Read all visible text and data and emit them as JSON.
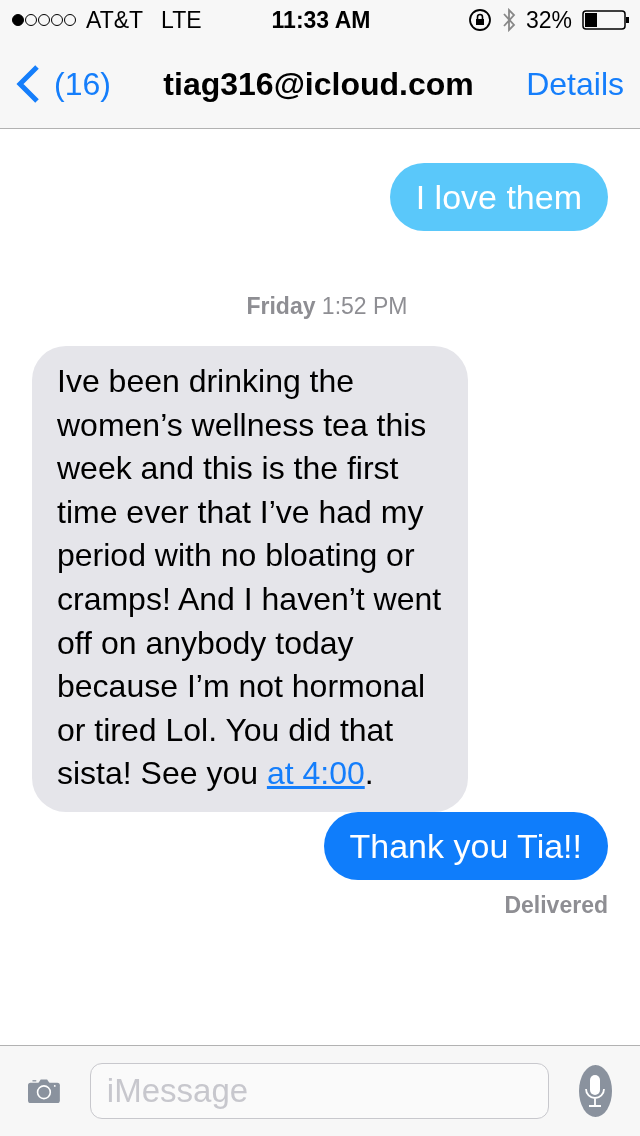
{
  "status_bar": {
    "carrier": "AT&T",
    "network": "LTE",
    "time": "11:33 AM",
    "battery": "32%"
  },
  "nav": {
    "back": "(16)",
    "title": "tiag316@icloud.com",
    "action": "Details"
  },
  "messages": [
    {
      "kind": "outgoing",
      "text": "I love them",
      "color": "#5ac8fa"
    },
    {
      "kind": "timestamp",
      "text": "**Friday** 1:52 PM"
    },
    {
      "kind": "incoming",
      "text": "Ive been drinking the women’s wellness tea this week and this is the first time ever that I’ve had my period with no bloating or cramps! And I haven’t went off on anybody today because I’m not hormonal or tired Lol. You did that sista! See you ",
      "link": "at 4:00",
      "text_after": "."
    },
    {
      "kind": "outgoing",
      "text": "Thank you Tia!!",
      "color": "#0f7dfb"
    },
    {
      "kind": "delivered",
      "text": "Delivered"
    }
  ],
  "composer": {
    "placeholder": "iMessage"
  }
}
